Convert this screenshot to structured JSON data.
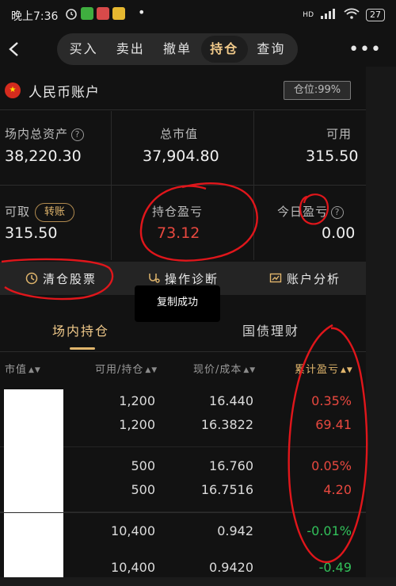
{
  "status_bar": {
    "time": "晚上7:36",
    "icons": [
      "alarm-icon",
      "app-icon",
      "app-icon",
      "app-icon"
    ],
    "network": "HD",
    "battery": "27"
  },
  "nav": {
    "tabs": [
      {
        "label": "买入",
        "active": false
      },
      {
        "label": "卖出",
        "active": false
      },
      {
        "label": "撤单",
        "active": false
      },
      {
        "label": "持仓",
        "active": true
      },
      {
        "label": "查询",
        "active": false
      }
    ],
    "more": "•••"
  },
  "account": {
    "name": "人民币账户",
    "position_label": "仓位:99%"
  },
  "assets": {
    "total_label": "场内总资产",
    "total_value": "38,220.30",
    "market_label": "总市值",
    "market_value": "37,904.80",
    "available_label": "可用",
    "available_value": "315.50",
    "withdrawable_label": "可取",
    "transfer_label": "转账",
    "withdrawable_value": "315.50",
    "pnl_label": "持仓盈亏",
    "pnl_value": "73.12",
    "today_pnl_label": "今日盈亏",
    "today_pnl_value": "0.00"
  },
  "actions": {
    "clear": "清仓股票",
    "diagnose": "操作诊断",
    "analysis": "账户分析"
  },
  "toast": "复制成功",
  "holding_tabs": {
    "active": "场内持仓",
    "inactive": "国债理财"
  },
  "table": {
    "headers": [
      "市值",
      "可用/持仓",
      "现价/成本",
      "累计盈亏"
    ],
    "rows": [
      {
        "qty_available": "1,200",
        "qty_held": "1,200",
        "price": "16.440",
        "cost": "16.3822",
        "pnl_pct": "0.35%",
        "pnl": "69.41",
        "tone": "red"
      },
      {
        "qty_available": "500",
        "qty_held": "500",
        "price": "16.760",
        "cost": "16.7516",
        "pnl_pct": "0.05%",
        "pnl": "4.20",
        "tone": "red"
      },
      {
        "qty_available": "10,400",
        "qty_held": "10,400",
        "price": "0.942",
        "cost": "0.9420",
        "pnl_pct": "-0.01%",
        "pnl": "-0.49",
        "tone": "green"
      }
    ]
  },
  "colors": {
    "accent_gold": "#e0b56c",
    "profit_red": "#e8483f",
    "loss_green": "#32c05a",
    "annotation_red": "#e0161b"
  }
}
